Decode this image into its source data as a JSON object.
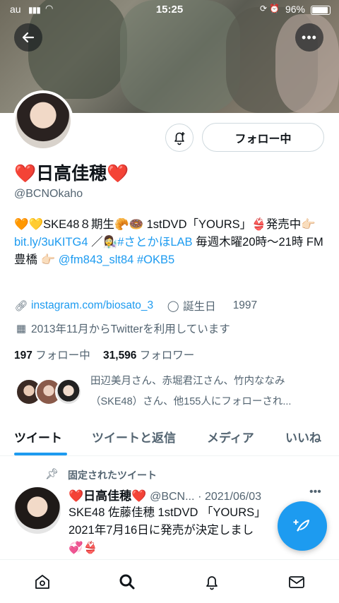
{
  "status_bar": {
    "carrier": "au",
    "time": "15:25",
    "battery": "96%"
  },
  "profile": {
    "name": "❤️日高佳穂❤️",
    "handle": "@BCNOkaho",
    "follow_label": "フォロー中",
    "bio": {
      "line_segments": [
        {
          "text": "🧡💛SKE48８期生🥐🍩 1stDVD「YOURS」👙発売中👉🏻 ",
          "type": "text"
        },
        {
          "text": "bit.ly/3uKITG4",
          "type": "link"
        },
        {
          "text": " ／👩‍🔬",
          "type": "text"
        },
        {
          "text": "#さとかほLAB",
          "type": "link"
        },
        {
          "text": " 毎週木曜20時〜21時 FM豊橋 👉🏻 ",
          "type": "text"
        },
        {
          "text": "@fm843_slt84",
          "type": "link"
        },
        {
          "text": " ",
          "type": "text"
        },
        {
          "text": "#OKB5",
          "type": "link"
        }
      ]
    },
    "website": "instagram.com/biosato_3",
    "birthday_label": "誕生日",
    "birthday_value": "1997",
    "joined": "2013年11月からTwitterを利用しています",
    "following_count": "197",
    "following_label": "フォロー中",
    "followers_count": "31,596",
    "followers_label": "フォロワー",
    "followed_by_text": "田辺美月さん、赤堀君江さん、竹内ななみ（SKE48）さん、他155人にフォローされ..."
  },
  "tabs": [
    {
      "label": "ツイート",
      "active": true
    },
    {
      "label": "ツイートと返信",
      "active": false
    },
    {
      "label": "メディア",
      "active": false
    },
    {
      "label": "いいね",
      "active": false
    }
  ],
  "pinned_tweet": {
    "pinned_label": "固定されたツイート",
    "author_name": "❤️日高佳穂❤️",
    "author_handle": "@BCN...",
    "date": "· 2021/06/03",
    "text_line1": "SKE48 佐藤佳穂 1stDVD 「YOURS」",
    "text_line2": "2021年7月16日に発売が決定しまし",
    "text_line3": "💞👙"
  },
  "icons": {
    "back": "arrow-left-icon",
    "more": "ellipsis-icon",
    "notify": "bell-plus-icon",
    "link": "link-icon",
    "birthday": "balloon-icon",
    "calendar": "calendar-icon",
    "pin": "pin-icon",
    "compose": "feather-plus-icon",
    "home": "home-icon",
    "search": "search-icon",
    "notifications": "bell-icon",
    "messages": "envelope-icon"
  },
  "colors": {
    "accent": "#1d9bf0",
    "text": "#0f1419",
    "muted": "#536471"
  }
}
